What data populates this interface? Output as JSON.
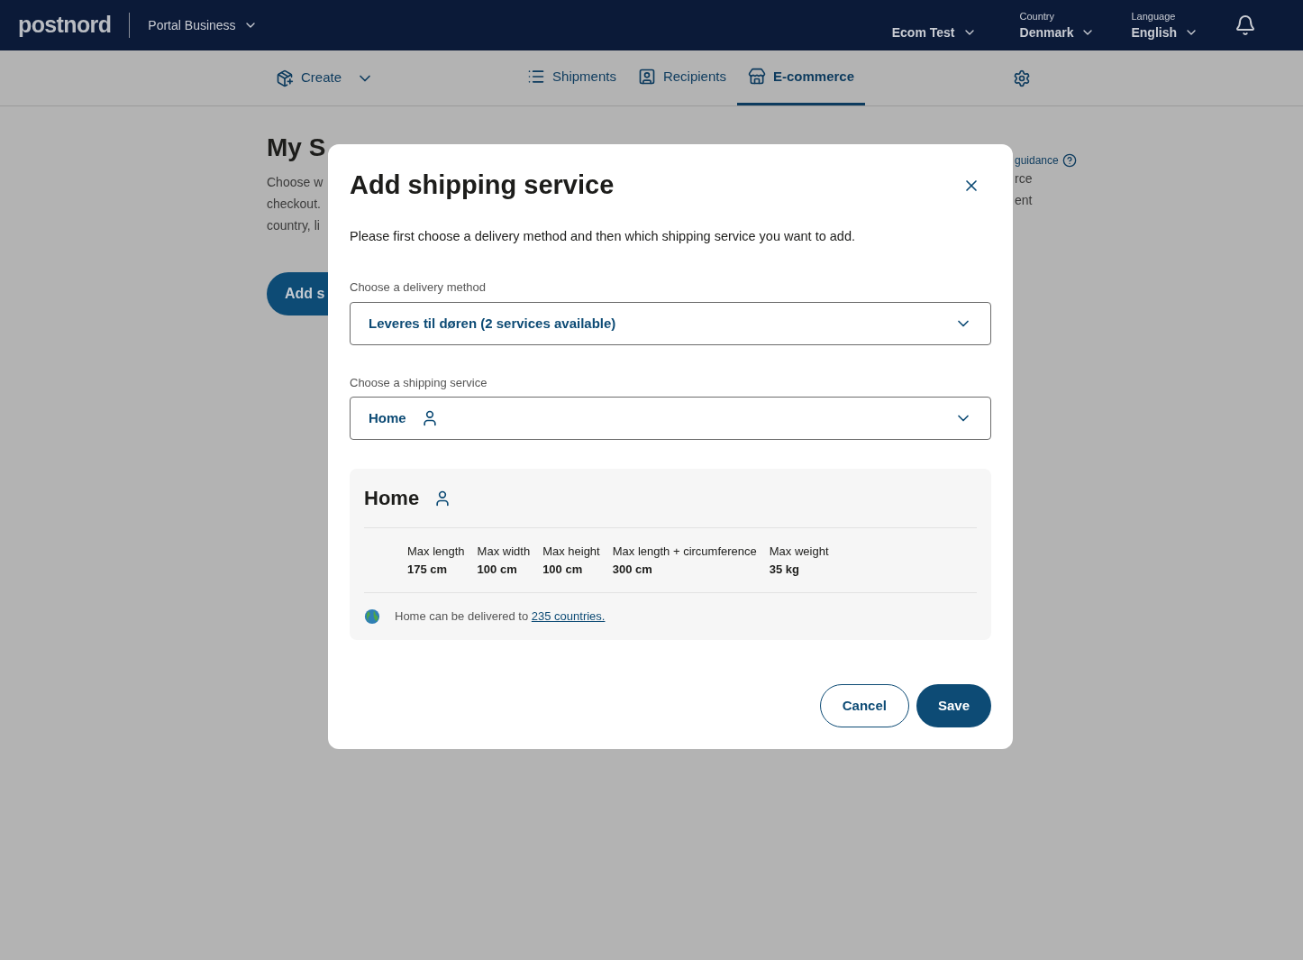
{
  "header": {
    "logo": "postnord",
    "portal": "Portal Business",
    "account": "Ecom Test",
    "country": {
      "label": "Country",
      "value": "Denmark"
    },
    "language": {
      "label": "Language",
      "value": "English"
    }
  },
  "nav": {
    "create": "Create",
    "tabs": [
      {
        "label": "Shipments",
        "selected": false
      },
      {
        "label": "Recipients",
        "selected": false
      },
      {
        "label": "E-commerce",
        "selected": true
      }
    ]
  },
  "background": {
    "title": "My S",
    "left_lines": [
      "Choose w",
      "checkout.",
      "country, li"
    ],
    "button": "Add s",
    "guidance": "guidance",
    "right_lines": [
      "rce",
      "ent"
    ]
  },
  "dialog": {
    "title": "Add shipping service",
    "intro": "Please first choose a delivery method and then which shipping service you want to add.",
    "fields": [
      {
        "label": "Choose a delivery method",
        "value": "Leveres til døren (2 services available)",
        "person_icon": false
      },
      {
        "label": "Choose a shipping service",
        "value": "Home",
        "person_icon": true
      }
    ],
    "card": {
      "title": "Home",
      "specs": [
        {
          "label": "Max length",
          "value": "175 cm"
        },
        {
          "label": "Max width",
          "value": "100 cm"
        },
        {
          "label": "Max height",
          "value": "100 cm"
        },
        {
          "label": "Max length + circumference",
          "value": "300 cm"
        },
        {
          "label": "Max weight",
          "value": "35 kg"
        }
      ],
      "note": "Home can be delivered to",
      "link": "235 countries."
    },
    "buttons": [
      {
        "label": "Cancel",
        "kind": "secondary"
      },
      {
        "label": "Save",
        "kind": "primary"
      }
    ]
  }
}
